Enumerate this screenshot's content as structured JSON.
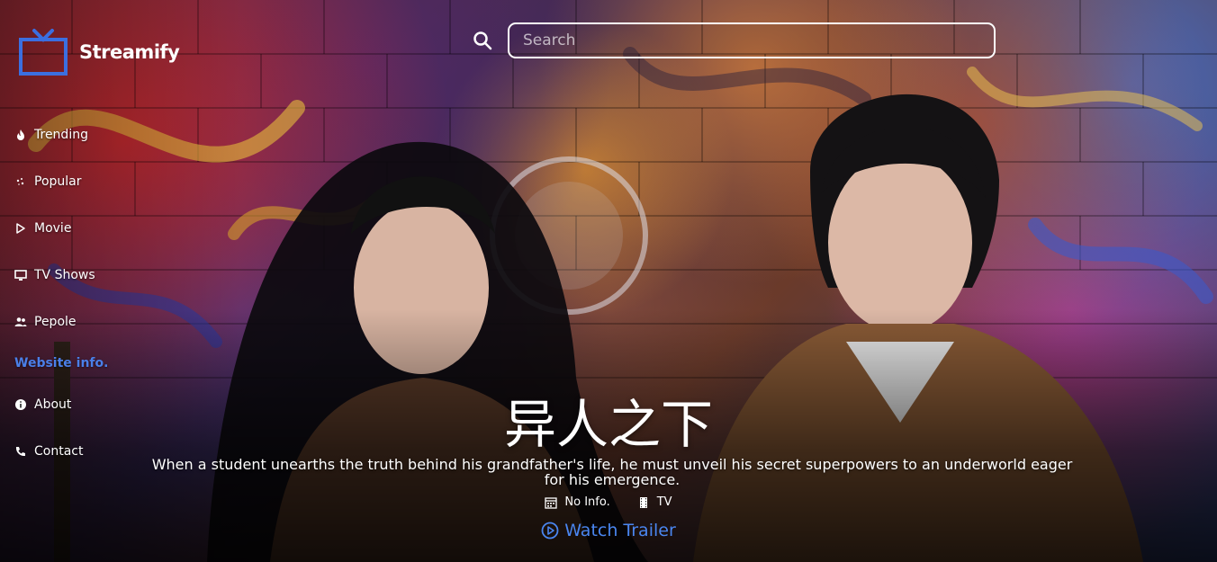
{
  "app": {
    "name": "Streamify",
    "accent_color": "#3b6fe0"
  },
  "search": {
    "placeholder": "Search",
    "value": ""
  },
  "sidebar": {
    "items": [
      {
        "label": "Trending",
        "icon": "flame-icon"
      },
      {
        "label": "Popular",
        "icon": "sparkle-icon"
      },
      {
        "label": "Movie",
        "icon": "play-outline-icon"
      },
      {
        "label": "TV Shows",
        "icon": "monitor-icon"
      },
      {
        "label": "Pepole",
        "icon": "people-icon"
      }
    ],
    "section_heading": "Website info.",
    "info_items": [
      {
        "label": "About",
        "icon": "info-icon"
      },
      {
        "label": "Contact",
        "icon": "phone-icon"
      }
    ]
  },
  "hero": {
    "title": "异人之下",
    "description": "When a student unearths the truth behind his grandfather's life, he must unveil his secret superpowers to an underworld eager for his emergence.",
    "release_info": "No Info.",
    "media_type": "TV",
    "trailer_label": "Watch Trailer"
  }
}
